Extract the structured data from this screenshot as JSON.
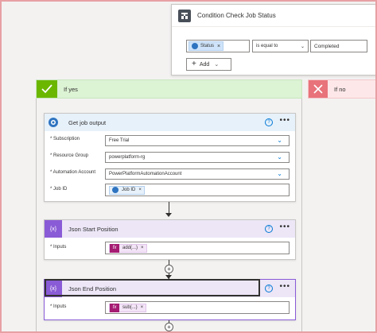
{
  "condition": {
    "title": "Condition Check Job Status",
    "token_label": "Status",
    "token_remove": "×",
    "operator": "is equal to",
    "value": "Completed",
    "add_label": "Add",
    "icon": "condition-icon"
  },
  "branches": {
    "yes_label": "If yes",
    "no_label": "If no"
  },
  "get_job_output": {
    "title": "Get job output",
    "help": "?",
    "more": "•••",
    "fields": [
      {
        "label": "* Subscription",
        "value": "Free Trial"
      },
      {
        "label": "* Resource Group",
        "value": "powerplatform-rg"
      },
      {
        "label": "* Automation Account",
        "value": "PowerPlatformAutomationAccount"
      },
      {
        "label": "* Job ID",
        "token": "Job ID",
        "token_remove": "×"
      }
    ]
  },
  "json_start": {
    "title": "Json Start Position",
    "help": "?",
    "more": "•••",
    "input_label": "* Inputs",
    "fx_symbol": "fx",
    "expression": "add(...)",
    "token_remove": "×"
  },
  "json_end": {
    "title": "Json End Position",
    "help": "?",
    "more": "•••",
    "input_label": "* Inputs",
    "fx_symbol": "fx",
    "expression": "sub(...)",
    "token_remove": "×"
  },
  "colors": {
    "accent": "#0078d4",
    "yes": "#6bb700",
    "no": "#e8737a",
    "expression": "#a51c72",
    "data_op": "#8a5bd6"
  }
}
